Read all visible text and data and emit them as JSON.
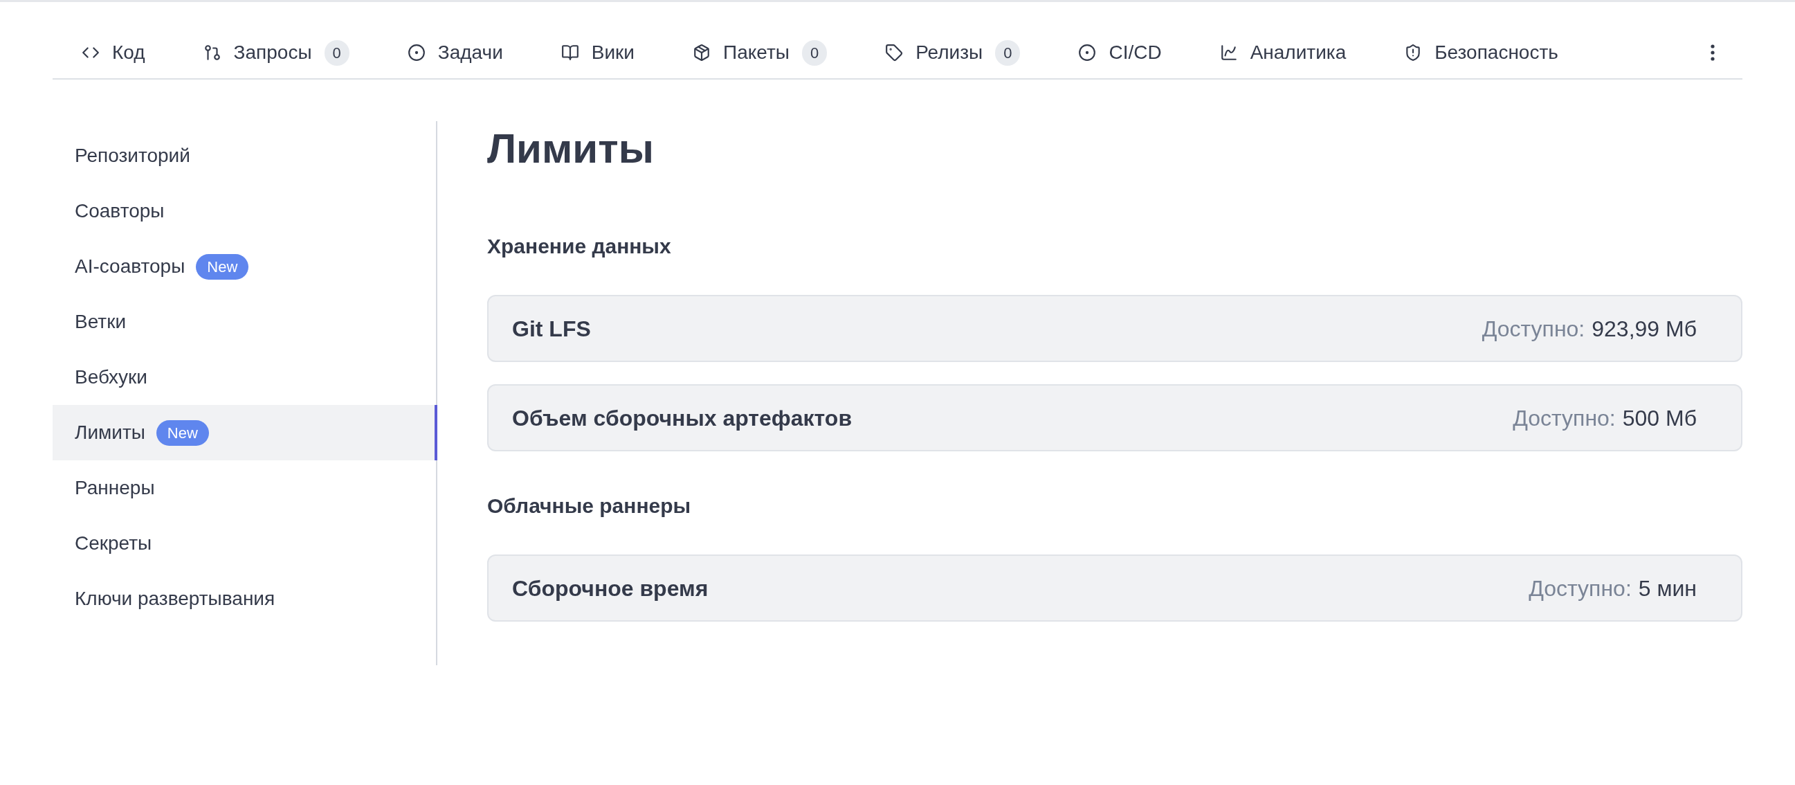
{
  "nav": {
    "tabs": [
      {
        "kind": "code",
        "label": "Код",
        "selected": false
      },
      {
        "kind": "pull",
        "label": "Запросы",
        "count": "0",
        "selected": false
      },
      {
        "kind": "issue",
        "label": "Задачи",
        "selected": false
      },
      {
        "kind": "book",
        "label": "Вики",
        "selected": false
      },
      {
        "kind": "package",
        "label": "Пакеты",
        "count": "0",
        "selected": false
      },
      {
        "kind": "tag",
        "label": "Релизы",
        "count": "0",
        "selected": false
      },
      {
        "kind": "issue",
        "label": "CI/CD",
        "selected": false
      },
      {
        "kind": "chart",
        "label": "Аналитика",
        "selected": false
      },
      {
        "kind": "shield",
        "label": "Безопасность",
        "selected": false
      }
    ]
  },
  "sidebar": {
    "items": [
      {
        "label": "Репозиторий",
        "selected": false
      },
      {
        "label": "Соавторы",
        "selected": false
      },
      {
        "label": "AI-соавторы",
        "badge": "New",
        "selected": false
      },
      {
        "label": "Ветки",
        "selected": false
      },
      {
        "label": "Вебхуки",
        "selected": false
      },
      {
        "label": "Лимиты",
        "badge": "New",
        "selected": true
      },
      {
        "label": "Раннеры",
        "selected": false
      },
      {
        "label": "Секреты",
        "selected": false
      },
      {
        "label": "Ключи развертывания",
        "selected": false
      }
    ]
  },
  "page_title": "Лимиты",
  "sections": [
    {
      "title": "Хранение данных",
      "rows": [
        {
          "name": "Git LFS",
          "label": "Доступно:",
          "value": "923,99 Мб"
        },
        {
          "name": "Объем сборочных артефактов",
          "label": "Доступно:",
          "value": "500 Мб"
        }
      ]
    },
    {
      "title": "Облачные раннеры",
      "rows": [
        {
          "name": "Сборочное время",
          "label": "Доступно:",
          "value": "5 мин"
        }
      ]
    }
  ]
}
